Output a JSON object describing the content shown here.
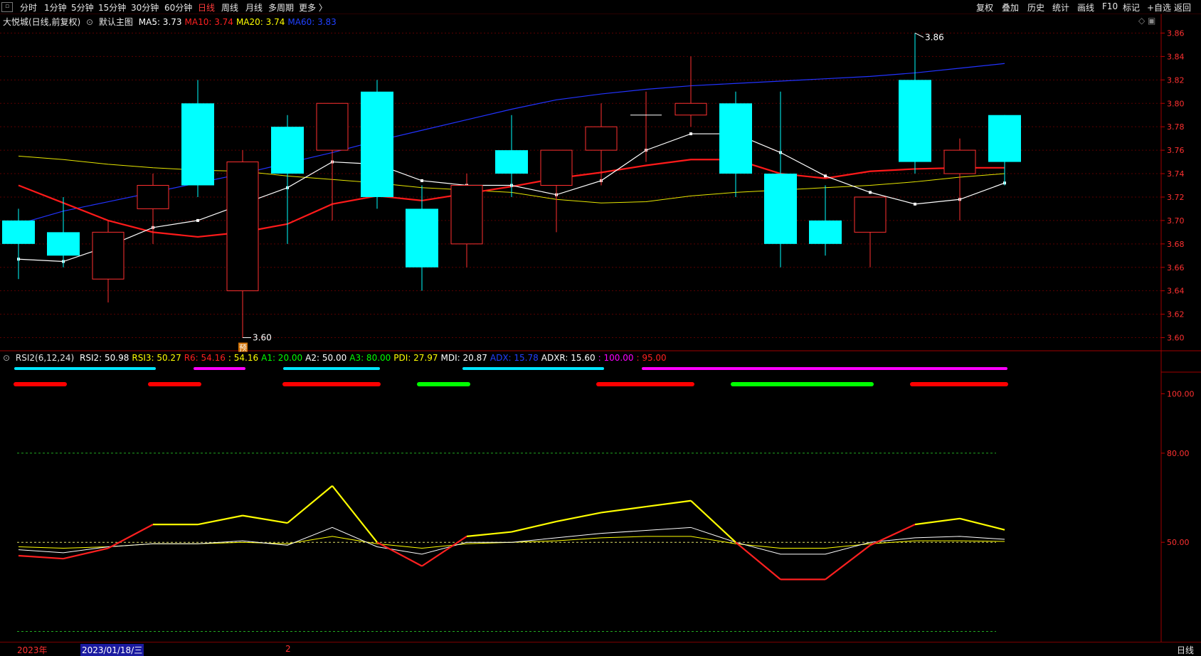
{
  "toolbar": {
    "menu_icon": "menu-icon",
    "left": [
      {
        "label": "分时"
      },
      {
        "label": "1分钟"
      },
      {
        "label": "5分钟"
      },
      {
        "label": "15分钟"
      },
      {
        "label": "30分钟"
      },
      {
        "label": "60分钟"
      },
      {
        "label": "日线",
        "active": true
      },
      {
        "label": "周线"
      },
      {
        "label": "月线"
      },
      {
        "label": "多周期"
      },
      {
        "label": "更多 〉"
      }
    ],
    "right": [
      {
        "label": "复权"
      },
      {
        "label": "叠加"
      },
      {
        "label": "历史"
      },
      {
        "label": "统计"
      },
      {
        "label": "画线"
      },
      {
        "label": "F10"
      },
      {
        "label": "标记"
      },
      {
        "label": "+自选"
      },
      {
        "label": "返回"
      }
    ]
  },
  "main_header": {
    "title": "大悦城(日线,前复权)",
    "template": "默认主图",
    "ma": [
      {
        "label": "MA5: 3.73",
        "color": "#ffffff"
      },
      {
        "label": "MA10: 3.74",
        "color": "#ff2020"
      },
      {
        "label": "MA20: 3.74",
        "color": "#ffff00"
      },
      {
        "label": "MA60: 3.83",
        "color": "#2040ff"
      }
    ]
  },
  "sub_header": {
    "title": "RSI2(6,12,24)",
    "items": [
      {
        "label": "RSI2: 50.98",
        "color": "#ffffff"
      },
      {
        "label": "RSI3: 50.27",
        "color": "#ffff00"
      },
      {
        "label": "R6: 54.16",
        "color": "#ff2020"
      },
      {
        "label": ": 54.16",
        "color": "#ffff00"
      },
      {
        "label": "A1: 20.00",
        "color": "#00ff00"
      },
      {
        "label": "A2: 50.00",
        "color": "#ffffff"
      },
      {
        "label": "A3: 80.00",
        "color": "#00ff00"
      },
      {
        "label": "PDI: 27.97",
        "color": "#ffff00"
      },
      {
        "label": "MDI: 20.87",
        "color": "#ffffff"
      },
      {
        "label": "ADX: 15.78",
        "color": "#2040ff"
      },
      {
        "label": "ADXR: 15.60",
        "color": "#ffffff"
      },
      {
        "label": ": 100.00",
        "color": "#ff00ff"
      },
      {
        "label": ": 95.00",
        "color": "#ff2020"
      }
    ]
  },
  "bottom": {
    "year_label": "2023年",
    "cursor_date": "2023/01/18/三",
    "marker": "2",
    "period_tab": "日线"
  },
  "colors": {
    "up": "#ff3030",
    "down": "#00ffff",
    "grid": "#6a0000",
    "axis": "#ff3030"
  },
  "chart_data": [
    {
      "type": "candlestick",
      "ylim": [
        3.59,
        3.87
      ],
      "yticks": [
        "3.86",
        "3.84",
        "3.82",
        "3.80",
        "3.78",
        "3.76",
        "3.74",
        "3.72",
        "3.70",
        "3.68",
        "3.66",
        "3.64",
        "3.62",
        "3.60"
      ],
      "candles": [
        {
          "o": 3.7,
          "c": 3.68,
          "h": 3.71,
          "l": 3.65
        },
        {
          "o": 3.69,
          "c": 3.67,
          "h": 3.72,
          "l": 3.66
        },
        {
          "o": 3.65,
          "c": 3.69,
          "h": 3.7,
          "l": 3.63
        },
        {
          "o": 3.71,
          "c": 3.73,
          "h": 3.74,
          "l": 3.68
        },
        {
          "o": 3.8,
          "c": 3.73,
          "h": 3.82,
          "l": 3.72
        },
        {
          "o": 3.64,
          "c": 3.75,
          "h": 3.76,
          "l": 3.6
        },
        {
          "o": 3.78,
          "c": 3.74,
          "h": 3.79,
          "l": 3.68
        },
        {
          "o": 3.76,
          "c": 3.8,
          "h": 3.8,
          "l": 3.7
        },
        {
          "o": 3.81,
          "c": 3.72,
          "h": 3.82,
          "l": 3.71
        },
        {
          "o": 3.71,
          "c": 3.66,
          "h": 3.73,
          "l": 3.64
        },
        {
          "o": 3.68,
          "c": 3.73,
          "h": 3.74,
          "l": 3.66
        },
        {
          "o": 3.76,
          "c": 3.74,
          "h": 3.79,
          "l": 3.72
        },
        {
          "o": 3.73,
          "c": 3.76,
          "h": 3.76,
          "l": 3.69
        },
        {
          "o": 3.76,
          "c": 3.78,
          "h": 3.8,
          "l": 3.73
        },
        {
          "o": 3.79,
          "c": 3.79,
          "h": 3.81,
          "l": 3.75
        },
        {
          "o": 3.79,
          "c": 3.8,
          "h": 3.84,
          "l": 3.78
        },
        {
          "o": 3.8,
          "c": 3.74,
          "h": 3.81,
          "l": 3.72
        },
        {
          "o": 3.74,
          "c": 3.68,
          "h": 3.81,
          "l": 3.66
        },
        {
          "o": 3.7,
          "c": 3.68,
          "h": 3.73,
          "l": 3.67
        },
        {
          "o": 3.69,
          "c": 3.72,
          "h": 3.72,
          "l": 3.66
        },
        {
          "o": 3.82,
          "c": 3.75,
          "h": 3.86,
          "l": 3.74
        },
        {
          "o": 3.74,
          "c": 3.76,
          "h": 3.77,
          "l": 3.7
        },
        {
          "o": 3.79,
          "c": 3.75,
          "h": 3.79,
          "l": 3.73
        }
      ],
      "ma5": [
        3.667,
        3.665,
        3.678,
        3.694,
        3.7,
        3.714,
        3.728,
        3.75,
        3.748,
        3.734,
        3.73,
        3.73,
        3.722,
        3.734,
        3.76,
        3.774,
        3.774,
        3.758,
        3.738,
        3.724,
        3.714,
        3.718,
        3.732
      ],
      "ma10": [
        3.73,
        3.715,
        3.7,
        3.69,
        3.686,
        3.69,
        3.697,
        3.714,
        3.721,
        3.717,
        3.723,
        3.729,
        3.736,
        3.741,
        3.747,
        3.752,
        3.752,
        3.74,
        3.736,
        3.742,
        3.744,
        3.745,
        3.745
      ],
      "ma20": [
        3.755,
        3.752,
        3.748,
        3.745,
        3.743,
        3.742,
        3.738,
        3.735,
        3.732,
        3.728,
        3.726,
        3.724,
        3.718,
        3.715,
        3.716,
        3.721,
        3.724,
        3.726,
        3.728,
        3.73,
        3.733,
        3.737,
        3.74
      ],
      "ma60": [
        3.697,
        3.708,
        3.716,
        3.724,
        3.732,
        3.74,
        3.749,
        3.758,
        3.768,
        3.777,
        3.786,
        3.795,
        3.803,
        3.808,
        3.812,
        3.815,
        3.817,
        3.819,
        3.821,
        3.823,
        3.826,
        3.83,
        3.834
      ],
      "high_label": "3.86",
      "low_label": "3.60",
      "pre_badge": "预"
    },
    {
      "type": "line",
      "ylim": [
        17,
        108
      ],
      "yticks": [
        "100.00",
        "80.00",
        "50.00"
      ],
      "series": [
        {
          "color": "#ff2020",
          "values": [
            45.5,
            44.5,
            48.0,
            56.0,
            56.0,
            59.0,
            56.5,
            69.0,
            50.0,
            42.0,
            52.0,
            53.5,
            57.0,
            60.0,
            62.0,
            64.0,
            50.0,
            37.5,
            37.5,
            49.0,
            56.0,
            58.0,
            54.2
          ]
        },
        {
          "color": "#ffffff",
          "values": [
            47.5,
            46.5,
            48.5,
            49.5,
            49.5,
            50.5,
            49.0,
            55.0,
            48.5,
            46.0,
            50.0,
            50.0,
            51.5,
            53.0,
            54.0,
            55.0,
            50.0,
            46.0,
            46.0,
            50.0,
            51.5,
            52.0,
            51.0
          ]
        },
        {
          "color": "#ffff00",
          "values": [
            48.5,
            48.0,
            48.5,
            49.5,
            49.5,
            50.0,
            49.5,
            52.0,
            49.5,
            48.0,
            49.5,
            50.0,
            50.5,
            51.5,
            52.0,
            52.0,
            49.5,
            48.0,
            48.0,
            49.5,
            50.5,
            50.5,
            50.3
          ]
        }
      ],
      "hlines": [
        {
          "value": 80,
          "color": "#22aa22"
        },
        {
          "value": 50,
          "color": "#dddd66"
        },
        {
          "value": 20,
          "color": "#22aa22"
        }
      ],
      "signals": [
        {
          "row": 0,
          "color": "#00e5ff",
          "from": 0,
          "to": 3
        },
        {
          "row": 0,
          "color": "#ff00ff",
          "from": 4,
          "to": 5
        },
        {
          "row": 0,
          "color": "#00e5ff",
          "from": 6,
          "to": 8
        },
        {
          "row": 0,
          "color": "#00e5ff",
          "from": 10,
          "to": 13
        },
        {
          "row": 0,
          "color": "#ff00ff",
          "from": 14,
          "to": 22
        },
        {
          "row": 1,
          "color": "#ff0000",
          "from": 0,
          "to": 1
        },
        {
          "row": 1,
          "color": "#ff0000",
          "from": 3,
          "to": 4
        },
        {
          "row": 1,
          "color": "#ff0000",
          "from": 6,
          "to": 8
        },
        {
          "row": 1,
          "color": "#00ff00",
          "from": 9,
          "to": 10
        },
        {
          "row": 1,
          "color": "#ff0000",
          "from": 13,
          "to": 15
        },
        {
          "row": 1,
          "color": "#00ff00",
          "from": 16,
          "to": 19
        },
        {
          "row": 1,
          "color": "#ff0000",
          "from": 20,
          "to": 22
        }
      ]
    }
  ]
}
